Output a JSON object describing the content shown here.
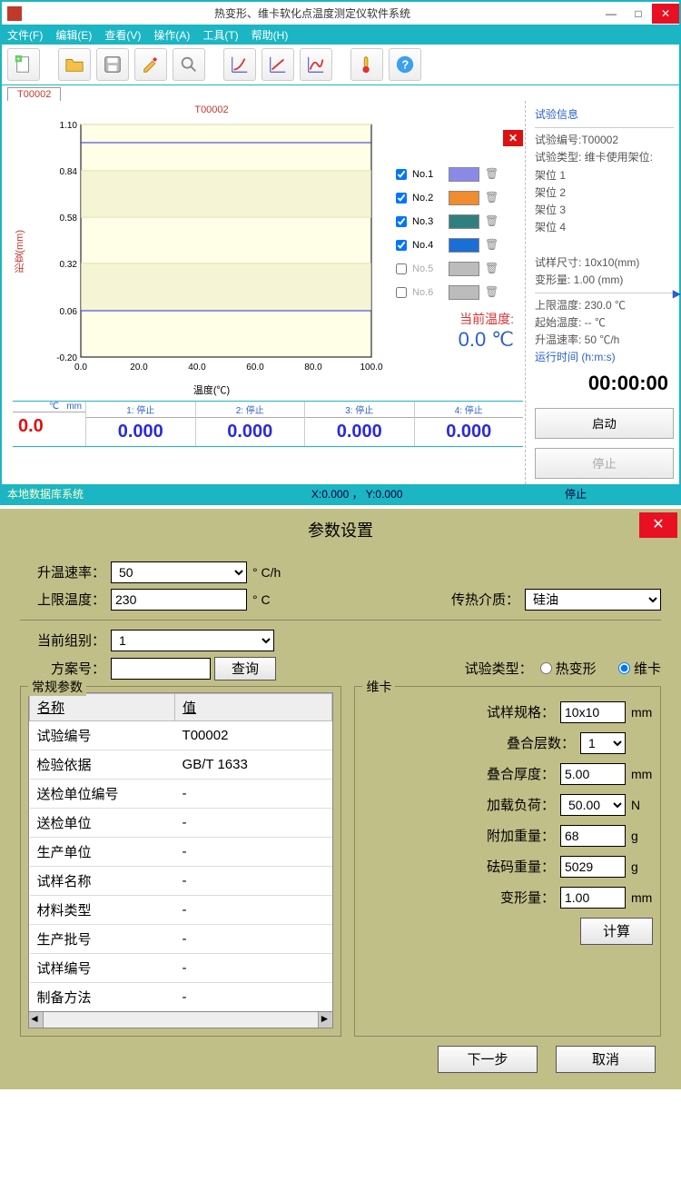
{
  "app": {
    "title": "热变形、维卡软化点温度测定仪软件系统",
    "menu": [
      "文件(F)",
      "编辑(E)",
      "查看(V)",
      "操作(A)",
      "工具(T)",
      "帮助(H)"
    ]
  },
  "tab_label": "T00002",
  "chart_data": {
    "type": "line",
    "title": "T00002",
    "xlabel": "温度(℃)",
    "ylabel": "形变(mm)",
    "xlim": [
      0,
      100
    ],
    "ylim": [
      -0.2,
      1.1
    ],
    "x_ticks": [
      0.0,
      20.0,
      40.0,
      60.0,
      80.0,
      100.0
    ],
    "y_ticks": [
      -0.2,
      0.06,
      0.32,
      0.58,
      0.84,
      1.1
    ],
    "series": [
      {
        "name": "No.1",
        "color": "#8a8ae6",
        "enabled": true
      },
      {
        "name": "No.2",
        "color": "#f08c2e",
        "enabled": true
      },
      {
        "name": "No.3",
        "color": "#2f7f7f",
        "enabled": true
      },
      {
        "name": "No.4",
        "color": "#1a6fd6",
        "enabled": true
      },
      {
        "name": "No.5",
        "color": "#bcbcbc",
        "enabled": false
      },
      {
        "name": "No.6",
        "color": "#bcbcbc",
        "enabled": false
      }
    ],
    "ref_lines_y": [
      0.06,
      1.0
    ]
  },
  "current_temp": {
    "label": "当前温度:",
    "value": "0.0 ℃"
  },
  "info": {
    "title": "试验信息",
    "lines": [
      "试验编号:T00002",
      "试验类型: 维卡使用架位:",
      "架位 1",
      "架位 2",
      "架位 3",
      "架位 4"
    ],
    "sample": "试样尺寸: 10x10(mm)",
    "deform": "变形量: 1.00 (mm)",
    "upper": "上限温度: 230.0 ℃",
    "start": "起始温度: -- ℃",
    "rate": "升温速率: 50 ℃/h",
    "runtime_label": "运行时间 (h:m:s)",
    "runtime_value": "00:00:00",
    "start_btn": "启动",
    "stop_btn": "停止"
  },
  "values_band": {
    "temp_unit": "℃",
    "mm_unit": "mm",
    "temp_value": "0.0",
    "cols": [
      {
        "hd": "1: 停止",
        "vl": "0.000"
      },
      {
        "hd": "2: 停止",
        "vl": "0.000"
      },
      {
        "hd": "3: 停止",
        "vl": "0.000"
      },
      {
        "hd": "4: 停止",
        "vl": "0.000"
      }
    ]
  },
  "status": {
    "left": "本地数据库系统",
    "mid": "X:0.000 ， Y:0.000",
    "right": "停止"
  },
  "dialog": {
    "title": "参数设置",
    "rate": {
      "label": "升温速率：",
      "value": "50",
      "unit": "° C/h"
    },
    "upper": {
      "label": "上限温度：",
      "value": "230",
      "unit": "° C"
    },
    "medium": {
      "label": "传热介质：",
      "value": "硅油"
    },
    "group": {
      "label": "当前组别：",
      "value": "1"
    },
    "plan": {
      "label": "方案号：",
      "value": "",
      "query_btn": "查询"
    },
    "type": {
      "label": "试验类型：",
      "opt1": "热变形",
      "opt2": "维卡",
      "selected": 2
    },
    "general_legend": "常规参数",
    "param_headers": [
      "名称",
      "值"
    ],
    "params": [
      {
        "n": "试验编号",
        "v": "T00002"
      },
      {
        "n": "检验依据",
        "v": "GB/T 1633"
      },
      {
        "n": "送检单位编号",
        "v": "-"
      },
      {
        "n": "送检单位",
        "v": "-"
      },
      {
        "n": "生产单位",
        "v": "-"
      },
      {
        "n": "试样名称",
        "v": "-"
      },
      {
        "n": "材料类型",
        "v": "-"
      },
      {
        "n": "生产批号",
        "v": "-"
      },
      {
        "n": "试样编号",
        "v": "-"
      },
      {
        "n": "制备方法",
        "v": "-"
      }
    ],
    "vicat_legend": "维卡",
    "vicat": {
      "spec": {
        "label": "试样规格：",
        "value": "10x10",
        "unit": "mm"
      },
      "layers": {
        "label": "叠合层数：",
        "value": "1"
      },
      "thick": {
        "label": "叠合厚度：",
        "value": "5.00",
        "unit": "mm"
      },
      "load": {
        "label": "加载负荷：",
        "value": "50.00",
        "unit": "N"
      },
      "extra": {
        "label": "附加重量：",
        "value": "68",
        "unit": "g"
      },
      "weight": {
        "label": "砝码重量：",
        "value": "5029",
        "unit": "g"
      },
      "deform": {
        "label": "变形量：",
        "value": "1.00",
        "unit": "mm"
      },
      "calc_btn": "计算"
    },
    "next_btn": "下一步",
    "cancel_btn": "取消"
  }
}
